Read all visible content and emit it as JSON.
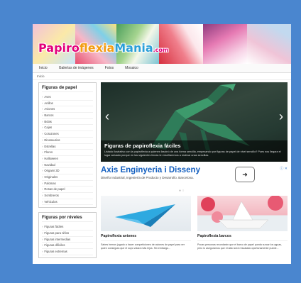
{
  "site": {
    "logo_text": "PapiroflexiaMania.com"
  },
  "nav": {
    "items": [
      "Inicio",
      "Galerías de imágenes",
      "Fotos",
      "Mosaico"
    ]
  },
  "breadcrumb": "Inicio",
  "sidebar": {
    "figuras_title": "Figuras de papel",
    "figuras": [
      "Aves",
      "Anillos",
      "Aviones",
      "Barcos",
      "Bolas",
      "Cajas",
      "Corazones",
      "Dinosaurios",
      "Estrellas",
      "Flores",
      "Halloween",
      "Navidad",
      "Origami 3D",
      "Originales",
      "Palomas",
      "Rosas de papel",
      "Sombreros",
      "Vehículos"
    ],
    "niveles_title": "Figuras por niveles",
    "niveles": [
      "Figuras fáciles",
      "Figuras para niños",
      "Figuras intermedias",
      "Figuras difíciles",
      "Figuras extremas"
    ]
  },
  "slider": {
    "title": "Figuras de papiroflexia fáciles",
    "description": "Listado ilustrativo con la papiroflexia a quienes fascinó de una forma sencilla, empezando por figuras de papel de nivel sencillo? Pues nos llegara el lugar actuado porque en las siguientes líneas te enseñaremos a realizar unas sencillas.",
    "prev_icon": "chevron-left-icon",
    "next_icon": "chevron-right-icon"
  },
  "ad": {
    "title": "Axis Enginyeria i Disseny",
    "subtitle": "Diseño Industrial, Ingeniería de Producto y Desarrollo. Barcelona.",
    "button_icon": "arrow-right-icon",
    "info_text": "ⓘ ✕"
  },
  "cards": [
    {
      "title": "Papiroflexia aviones",
      "text": "Sabes hemos jugado a hacer competiciones de aviones de papel para ver quien conseguía que el suyo volara más lejos. Sin embargo..."
    },
    {
      "title": "Papiroflexia barcos",
      "text": "Pocas personas recordarán que el barco de papel pueda surcar los aguas, pero lo aseguramos que el dato será rescatado oportunamente puede..."
    }
  ],
  "colors": {
    "background": "#4a86cf",
    "ad_title": "#1560c0"
  }
}
